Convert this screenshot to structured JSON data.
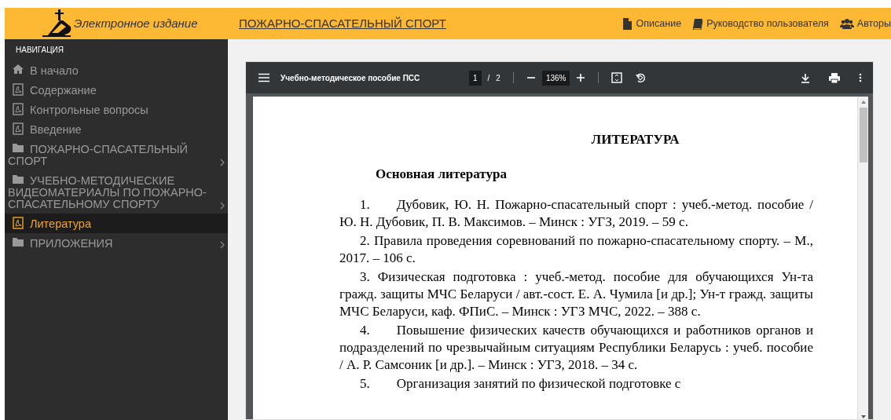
{
  "header": {
    "edition": "Электронное издание",
    "title": "ПОЖАРНО-СПАСАТЕЛЬНЫЙ СПОРТ",
    "links": [
      {
        "label": "Описание",
        "kind": "file"
      },
      {
        "label": "Руководство пользователя",
        "kind": "book"
      },
      {
        "label": "Авторы",
        "kind": "users"
      }
    ]
  },
  "sidebar": {
    "heading": "НАВИГАЦИЯ",
    "items": [
      {
        "label": "В начало",
        "kind": "home",
        "selected": false,
        "has_children": false
      },
      {
        "label": "Содержание",
        "kind": "pdf",
        "selected": false,
        "has_children": false
      },
      {
        "label": "Контрольные вопросы",
        "kind": "pdf",
        "selected": false,
        "has_children": false
      },
      {
        "label": "Введение",
        "kind": "pdf",
        "selected": false,
        "has_children": false
      },
      {
        "label": "ПОЖАРНО-СПАСАТЕЛЬНЫЙ СПОРТ",
        "kind": "folder",
        "selected": false,
        "has_children": true
      },
      {
        "label": "УЧЕБНО-МЕТОДИЧЕСКИЕ ВИДЕОМАТЕРИАЛЫ ПО ПОЖАРНО-СПАСАТЕЛЬНОМУ СПОРТУ",
        "kind": "folder",
        "selected": false,
        "has_children": true
      },
      {
        "label": "Литература",
        "kind": "pdf",
        "selected": true,
        "has_children": false
      },
      {
        "label": "ПРИЛОЖЕНИЯ",
        "kind": "folder",
        "selected": false,
        "has_children": true
      }
    ]
  },
  "viewer": {
    "title": "Учебно-методическое пособие ПСС",
    "page": "1",
    "page_separator": "/",
    "page_count": "2",
    "zoom": "136%",
    "document": {
      "heading": "ЛИТЕРАТУРА",
      "subheading": "Основная литература",
      "entries": [
        "1.  Дубовик, Ю. Н. Пожарно-спасательный спорт : учеб.-метод. пособие / Ю. Н. Дубовик, П. В. Максимов. – Минск : УГЗ, 2019. – 59 с.",
        "2. Правила проведения соревнований по пожарно-спасательному спорту. – М., 2017. – 106 с.",
        "3.  Физическая подготовка : учеб.-метод. пособие  для обучающихся Ун-та гражд. защиты МЧС Беларуси / авт.-сост. Е. А. Чумила [и др.]; Ун-т гражд. защиты МЧС Беларуси, каф. ФПиС. – Минск : УГЗ МЧС, 2022. – 388 с.",
        "4.  Повышение физических качеств обучающихся и работников органов и подразделений по чрезвычайным ситуациям Республики Беларусь : учеб. пособие / А. Р. Самсоник [и др.]. – Минск : УГЗ, 2018. – 34 с.",
        "5.  Организация занятий по физической подготовке с"
      ]
    }
  }
}
